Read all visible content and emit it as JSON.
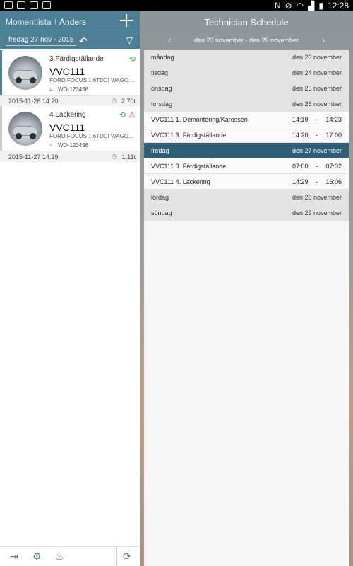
{
  "status_bar": {
    "time": "12:28",
    "icons": [
      "usb-icon",
      "image-icon",
      "image-icon",
      "bag-icon",
      "nfc-icon",
      "mute-icon",
      "wifi-icon",
      "signal-icon",
      "battery-icon"
    ]
  },
  "left": {
    "header": {
      "title": "Momentlista",
      "separator": "I",
      "user": "Anders"
    },
    "toolbar": {
      "date": "fredag 27 nov - 2015",
      "undo_icon": "↶",
      "filter_icon": "▽"
    },
    "tasks": [
      {
        "step": "3.Färdigställande",
        "plate": "VVC111",
        "model": "FORD FOCUS 1.6TDCI WAGO...",
        "wo": "WO-123456",
        "datetime": "2015-11-26 14:20",
        "duration": "2,70t",
        "stripe_color": "#4d7f95"
      },
      {
        "step": "4.Lackering",
        "plate": "VVC111",
        "model": "FORD FOCUS 1.6TDCI WAGO...",
        "wo": "WO-123456",
        "datetime": "2015-11-27 14:29",
        "duration": "1,11t",
        "stripe_color": "#c9c9c9"
      }
    ]
  },
  "right": {
    "title": "Technician Schedule",
    "week_range": "den 23 november - den 29 november",
    "rows": [
      {
        "kind": "day",
        "label": "måndag",
        "date": "den 23 november"
      },
      {
        "kind": "day",
        "label": "tisdag",
        "date": "den 24 november"
      },
      {
        "kind": "day",
        "label": "onsdag",
        "date": "den 25 november"
      },
      {
        "kind": "day",
        "label": "torsdag",
        "date": "den 26 november"
      },
      {
        "kind": "job",
        "label": "VVC111 1. Demontering/Karosseri",
        "start": "14:19",
        "end": "14:23"
      },
      {
        "kind": "job",
        "label": "VVC111 3. Färdigställande",
        "start": "14:20",
        "end": "17:00"
      },
      {
        "kind": "day",
        "label": "fredag",
        "date": "den 27 november",
        "active": true
      },
      {
        "kind": "job",
        "label": "VVC111 3. Färdigställande",
        "start": "07:00",
        "end": "07:32"
      },
      {
        "kind": "job",
        "label": "VVC111 4. Lackering",
        "start": "14:29",
        "end": "16:06"
      },
      {
        "kind": "day",
        "label": "lördag",
        "date": "den 28 november"
      },
      {
        "kind": "day",
        "label": "söndag",
        "date": "den 29 november"
      }
    ]
  }
}
